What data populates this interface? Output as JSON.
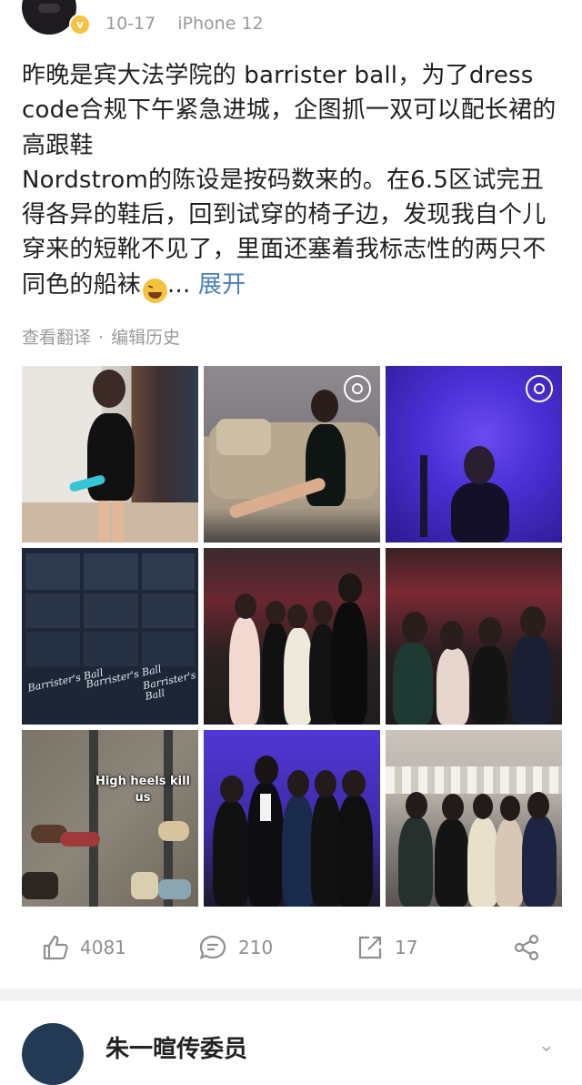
{
  "post": {
    "date": "10-17",
    "device": "iPhone 12",
    "paragraph1": "昨晚是宾大法学院的 barrister ball，为了dress code合规下午紧急进城，企图抓一双可以配长裙的高跟鞋",
    "paragraph2": "Nordstrom的陈设是按码数来的。在6.5区试完丑得各异的鞋后，回到试穿的椅子边，发现我自个儿穿来的短靴不见了，里面还塞着我标志性的两只不同色的船袜",
    "ellipsis": "...",
    "expand_label": "展开",
    "translate_label": "查看翻译",
    "separator": "·",
    "edit_history_label": "编辑历史",
    "photo_overlay_text": "High heels kill us",
    "photo_poster_text": "Barrister's Ball"
  },
  "actions": {
    "likes": "4081",
    "comments": "210",
    "reposts": "17"
  },
  "next_post": {
    "author": "朱一暄传委员"
  },
  "icons": {
    "verified": "verified-badge-icon",
    "like": "thumbs-up-icon",
    "comment": "comment-icon",
    "repost": "repost-icon",
    "share": "share-icon",
    "live_photo": "live-photo-icon",
    "more": "chevron-down-icon"
  },
  "colors": {
    "link": "#4a7ebb",
    "meta": "#9a9a9a",
    "verified": "#f6c244"
  }
}
